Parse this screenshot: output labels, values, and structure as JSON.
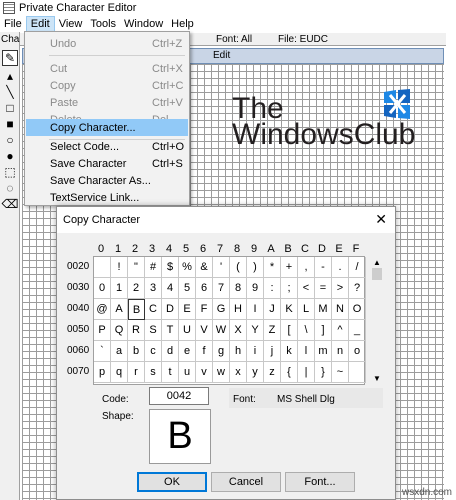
{
  "window": {
    "title": "Private Character Editor"
  },
  "menubar": [
    "File",
    "Edit",
    "View",
    "Tools",
    "Window",
    "Help"
  ],
  "tools": {
    "label": "Chara"
  },
  "charinfo": {
    "font": "Font: All",
    "file": "File: EUDC"
  },
  "edit_panel": {
    "header": "Edit"
  },
  "brand": {
    "line1": "The",
    "line2": "WindowsClub"
  },
  "edit_menu": {
    "items": [
      {
        "label": "Undo",
        "shortcut": "Ctrl+Z"
      },
      {
        "label": "Cut",
        "shortcut": "Ctrl+X"
      },
      {
        "label": "Copy",
        "shortcut": "Ctrl+C"
      },
      {
        "label": "Paste",
        "shortcut": "Ctrl+V"
      },
      {
        "label": "Delete",
        "shortcut": "Del"
      },
      {
        "label": "Copy Character...",
        "shortcut": ""
      },
      {
        "label": "Select Code...",
        "shortcut": "Ctrl+O"
      },
      {
        "label": "Save Character",
        "shortcut": "Ctrl+S"
      },
      {
        "label": "Save Character As...",
        "shortcut": ""
      },
      {
        "label": "TextService Link...",
        "shortcut": ""
      }
    ]
  },
  "dialog": {
    "title": "Copy Character",
    "columns": [
      "0",
      "1",
      "2",
      "3",
      "4",
      "5",
      "6",
      "7",
      "8",
      "9",
      "A",
      "B",
      "C",
      "D",
      "E",
      "F"
    ],
    "rows": [
      {
        "code": "0020",
        "cells": [
          "",
          "!",
          "\"",
          "#",
          "$",
          "%",
          "&",
          "'",
          "(",
          ")",
          "*",
          "+",
          ",",
          "-",
          ".",
          "/"
        ]
      },
      {
        "code": "0030",
        "cells": [
          "0",
          "1",
          "2",
          "3",
          "4",
          "5",
          "6",
          "7",
          "8",
          "9",
          ":",
          ";",
          "<",
          "=",
          ">",
          "?"
        ]
      },
      {
        "code": "0040",
        "cells": [
          "@",
          "A",
          "B",
          "C",
          "D",
          "E",
          "F",
          "G",
          "H",
          "I",
          "J",
          "K",
          "L",
          "M",
          "N",
          "O"
        ]
      },
      {
        "code": "0050",
        "cells": [
          "P",
          "Q",
          "R",
          "S",
          "T",
          "U",
          "V",
          "W",
          "X",
          "Y",
          "Z",
          "[",
          "\\",
          "]",
          "^",
          "_"
        ]
      },
      {
        "code": "0060",
        "cells": [
          "`",
          "a",
          "b",
          "c",
          "d",
          "e",
          "f",
          "g",
          "h",
          "i",
          "j",
          "k",
          "l",
          "m",
          "n",
          "o"
        ]
      },
      {
        "code": "0070",
        "cells": [
          "p",
          "q",
          "r",
          "s",
          "t",
          "u",
          "v",
          "w",
          "x",
          "y",
          "z",
          "{",
          "|",
          "}",
          "~",
          ""
        ]
      }
    ],
    "code_label": "Code:",
    "code_value": "0042",
    "font_label": "Font:",
    "font_value": "MS Shell Dlg",
    "shape_label": "Shape:",
    "shape_char": "B",
    "buttons": {
      "ok": "OK",
      "cancel": "Cancel",
      "font": "Font..."
    }
  },
  "watermark": "wsxdn.com"
}
